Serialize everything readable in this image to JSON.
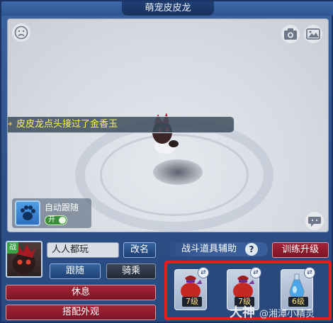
{
  "window": {
    "title": "萌宠皮皮龙"
  },
  "scene": {
    "notification": "皮皮龙点头接过了金香玉",
    "auto_follow": {
      "label": "自动跟随",
      "toggle_text": "开"
    },
    "icons": [
      "sad-face-icon",
      "camera-icon",
      "picture-icon",
      "speech-bubble-icon"
    ]
  },
  "pet": {
    "battle_tag": "战",
    "name": "人人都玩"
  },
  "buttons": {
    "rename": "改名",
    "follow": "跟随",
    "ride": "骑乘",
    "rest": "休息",
    "appearance": "搭配外观",
    "train": "训练升级"
  },
  "assist": {
    "label": "战斗道具辅助",
    "help": "?"
  },
  "items": [
    {
      "icon": "red-bag-icon",
      "level": "7级"
    },
    {
      "icon": "red-bag-icon",
      "level": "7级"
    },
    {
      "icon": "blue-potion-icon",
      "level": "6级"
    }
  ],
  "watermark": {
    "brand": "大神",
    "text": "@湘潭小精灵"
  },
  "colors": {
    "highlight_border": "#e81c1c",
    "notify_text": "#fff45a",
    "level_text": "#ffe37a"
  }
}
